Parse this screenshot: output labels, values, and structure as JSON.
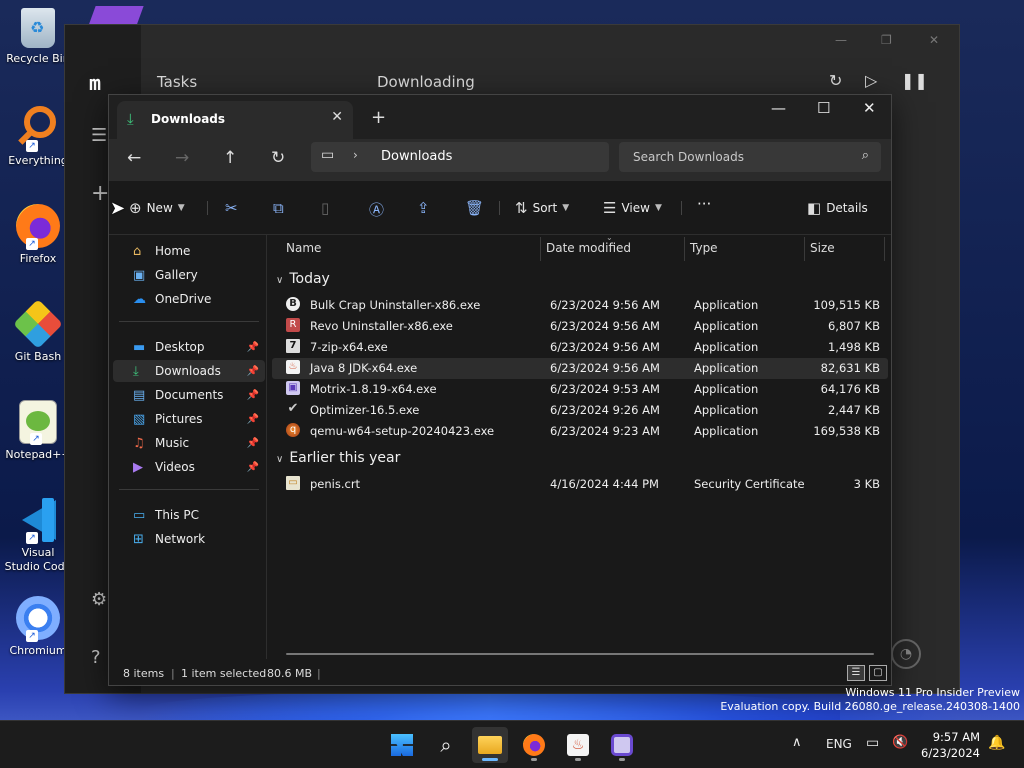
{
  "desktop": {
    "icons": [
      {
        "label": "Recycle Bin",
        "icon": "recycle-bin-icon"
      },
      {
        "label": "Everything",
        "icon": "everything-icon"
      },
      {
        "label": "Firefox",
        "icon": "firefox-icon"
      },
      {
        "label": "Git Bash",
        "icon": "git-bash-icon"
      },
      {
        "label": "Notepad++",
        "icon": "notepad-plus-plus-icon"
      },
      {
        "label": "Visual Studio Code",
        "icon": "vscode-icon"
      },
      {
        "label": "Chromium",
        "icon": "chromium-icon"
      }
    ]
  },
  "background_app": {
    "logo": "m",
    "section_title": "Tasks",
    "list_title": "Downloading"
  },
  "explorer": {
    "tab_title": "Downloads",
    "address": {
      "current": "Downloads"
    },
    "search": {
      "placeholder": "Search Downloads"
    },
    "commands": {
      "new": "New",
      "sort": "Sort",
      "view": "View",
      "more": "···",
      "details": "Details"
    },
    "nav": {
      "home": "Home",
      "gallery": "Gallery",
      "onedrive": "OneDrive",
      "desktop": "Desktop",
      "downloads": "Downloads",
      "documents": "Documents",
      "pictures": "Pictures",
      "music": "Music",
      "videos": "Videos",
      "thispc": "This PC",
      "network": "Network"
    },
    "columns": {
      "name": "Name",
      "date": "Date modified",
      "type": "Type",
      "size": "Size"
    },
    "groups": [
      {
        "title": "Today",
        "files": [
          {
            "name": "Bulk Crap Uninstaller-x86.exe",
            "date": "6/23/2024 9:56 AM",
            "type": "Application",
            "size": "109,515 KB"
          },
          {
            "name": "Revo Uninstaller-x86.exe",
            "date": "6/23/2024 9:56 AM",
            "type": "Application",
            "size": "6,807 KB"
          },
          {
            "name": "7-zip-x64.exe",
            "date": "6/23/2024 9:56 AM",
            "type": "Application",
            "size": "1,498 KB"
          },
          {
            "name": "Java 8 JDK-x64.exe",
            "date": "6/23/2024 9:56 AM",
            "type": "Application",
            "size": "82,631 KB"
          },
          {
            "name": "Motrix-1.8.19-x64.exe",
            "date": "6/23/2024 9:53 AM",
            "type": "Application",
            "size": "64,176 KB"
          },
          {
            "name": "Optimizer-16.5.exe",
            "date": "6/23/2024 9:26 AM",
            "type": "Application",
            "size": "2,447 KB"
          },
          {
            "name": "qemu-w64-setup-20240423.exe",
            "date": "6/23/2024 9:23 AM",
            "type": "Application",
            "size": "169,538 KB"
          }
        ]
      },
      {
        "title": "Earlier this year",
        "files": [
          {
            "name": "penis.crt",
            "date": "4/16/2024 4:44 PM",
            "type": "Security Certificate",
            "size": "3 KB"
          }
        ]
      }
    ],
    "status": {
      "count": "8 items",
      "selected": "1 item selected",
      "size": "80.6 MB"
    }
  },
  "watermark": {
    "line1": "Windows 11 Pro Insider Preview",
    "line2": "Evaluation copy. Build 26080.ge_release.240308-1400"
  },
  "taskbar": {
    "language": "ENG",
    "time": "9:57 AM",
    "date": "6/23/2024"
  }
}
